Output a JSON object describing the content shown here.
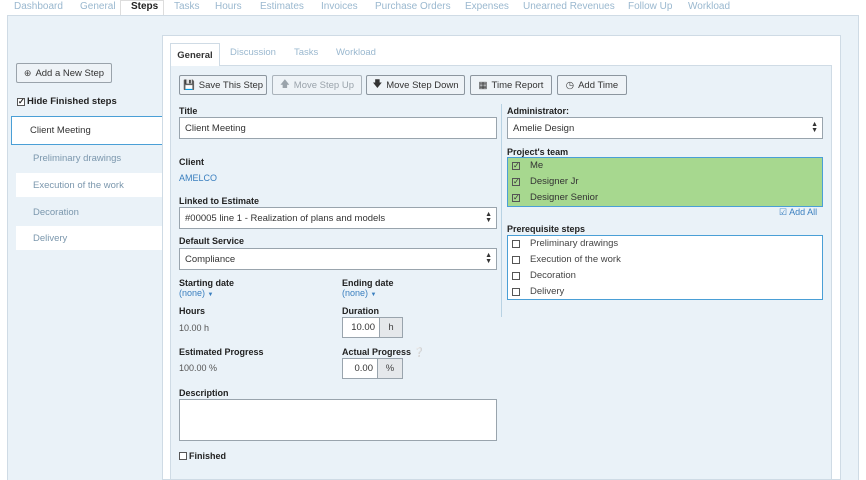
{
  "top_tabs": [
    {
      "label": "Dashboard",
      "active": false
    },
    {
      "label": "General",
      "active": false
    },
    {
      "label": "Steps",
      "active": true
    },
    {
      "label": "Tasks",
      "active": false
    },
    {
      "label": "Hours",
      "active": false
    },
    {
      "label": "Estimates",
      "active": false
    },
    {
      "label": "Invoices",
      "active": false
    },
    {
      "label": "Purchase Orders",
      "active": false
    },
    {
      "label": "Expenses",
      "active": false
    },
    {
      "label": "Unearned Revenues",
      "active": false
    },
    {
      "label": "Follow Up",
      "active": false
    },
    {
      "label": "Workload",
      "active": false
    }
  ],
  "sidebar": {
    "add_step_label": "Add a New Step",
    "hide_finished_label": "Hide Finished steps",
    "steps": [
      {
        "label": "Client Meeting",
        "active": true
      },
      {
        "label": "Preliminary drawings",
        "active": false
      },
      {
        "label": "Execution of the work",
        "active": false
      },
      {
        "label": "Decoration",
        "active": false
      },
      {
        "label": "Delivery",
        "active": false
      }
    ]
  },
  "inner_tabs": [
    {
      "label": "General",
      "active": true
    },
    {
      "label": "Discussion",
      "active": false
    },
    {
      "label": "Tasks",
      "active": false
    },
    {
      "label": "Workload",
      "active": false
    }
  ],
  "toolbar": {
    "save": "Save This Step",
    "move_up": "Move Step Up",
    "move_down": "Move Step Down",
    "time_report": "Time Report",
    "add_time": "Add Time"
  },
  "form": {
    "title_label": "Title",
    "title_value": "Client Meeting",
    "client_label": "Client",
    "client_value": "AMELCO",
    "estimate_label": "Linked to Estimate",
    "estimate_value": "#00005 line 1 - Realization of plans and models",
    "service_label": "Default Service",
    "service_value": "Compliance",
    "start_label": "Starting date",
    "start_value": "(none)",
    "end_label": "Ending date",
    "end_value": "(none)",
    "hours_label": "Hours",
    "hours_value": "10.00 h",
    "duration_label": "Duration",
    "duration_value": "10.00",
    "duration_unit": "h",
    "est_progress_label": "Estimated Progress",
    "est_progress_value": "100.00 %",
    "actual_progress_label": "Actual Progress",
    "actual_progress_value": "0.00",
    "actual_progress_unit": "%",
    "description_label": "Description",
    "finished_label": "Finished"
  },
  "right": {
    "admin_label": "Administrator:",
    "admin_value": "Amelie Design",
    "team_label": "Project's team",
    "team": [
      "Me",
      "Designer Jr",
      "Designer Senior"
    ],
    "add_all_label": "Add All",
    "prereq_label": "Prerequisite steps",
    "prereqs": [
      "Preliminary drawings",
      "Execution of the work",
      "Decoration",
      "Delivery"
    ]
  },
  "colors": {
    "accent": "#4a9fd6",
    "team_bg": "#a7d88f",
    "panel_bg": "#eaf2f8"
  }
}
